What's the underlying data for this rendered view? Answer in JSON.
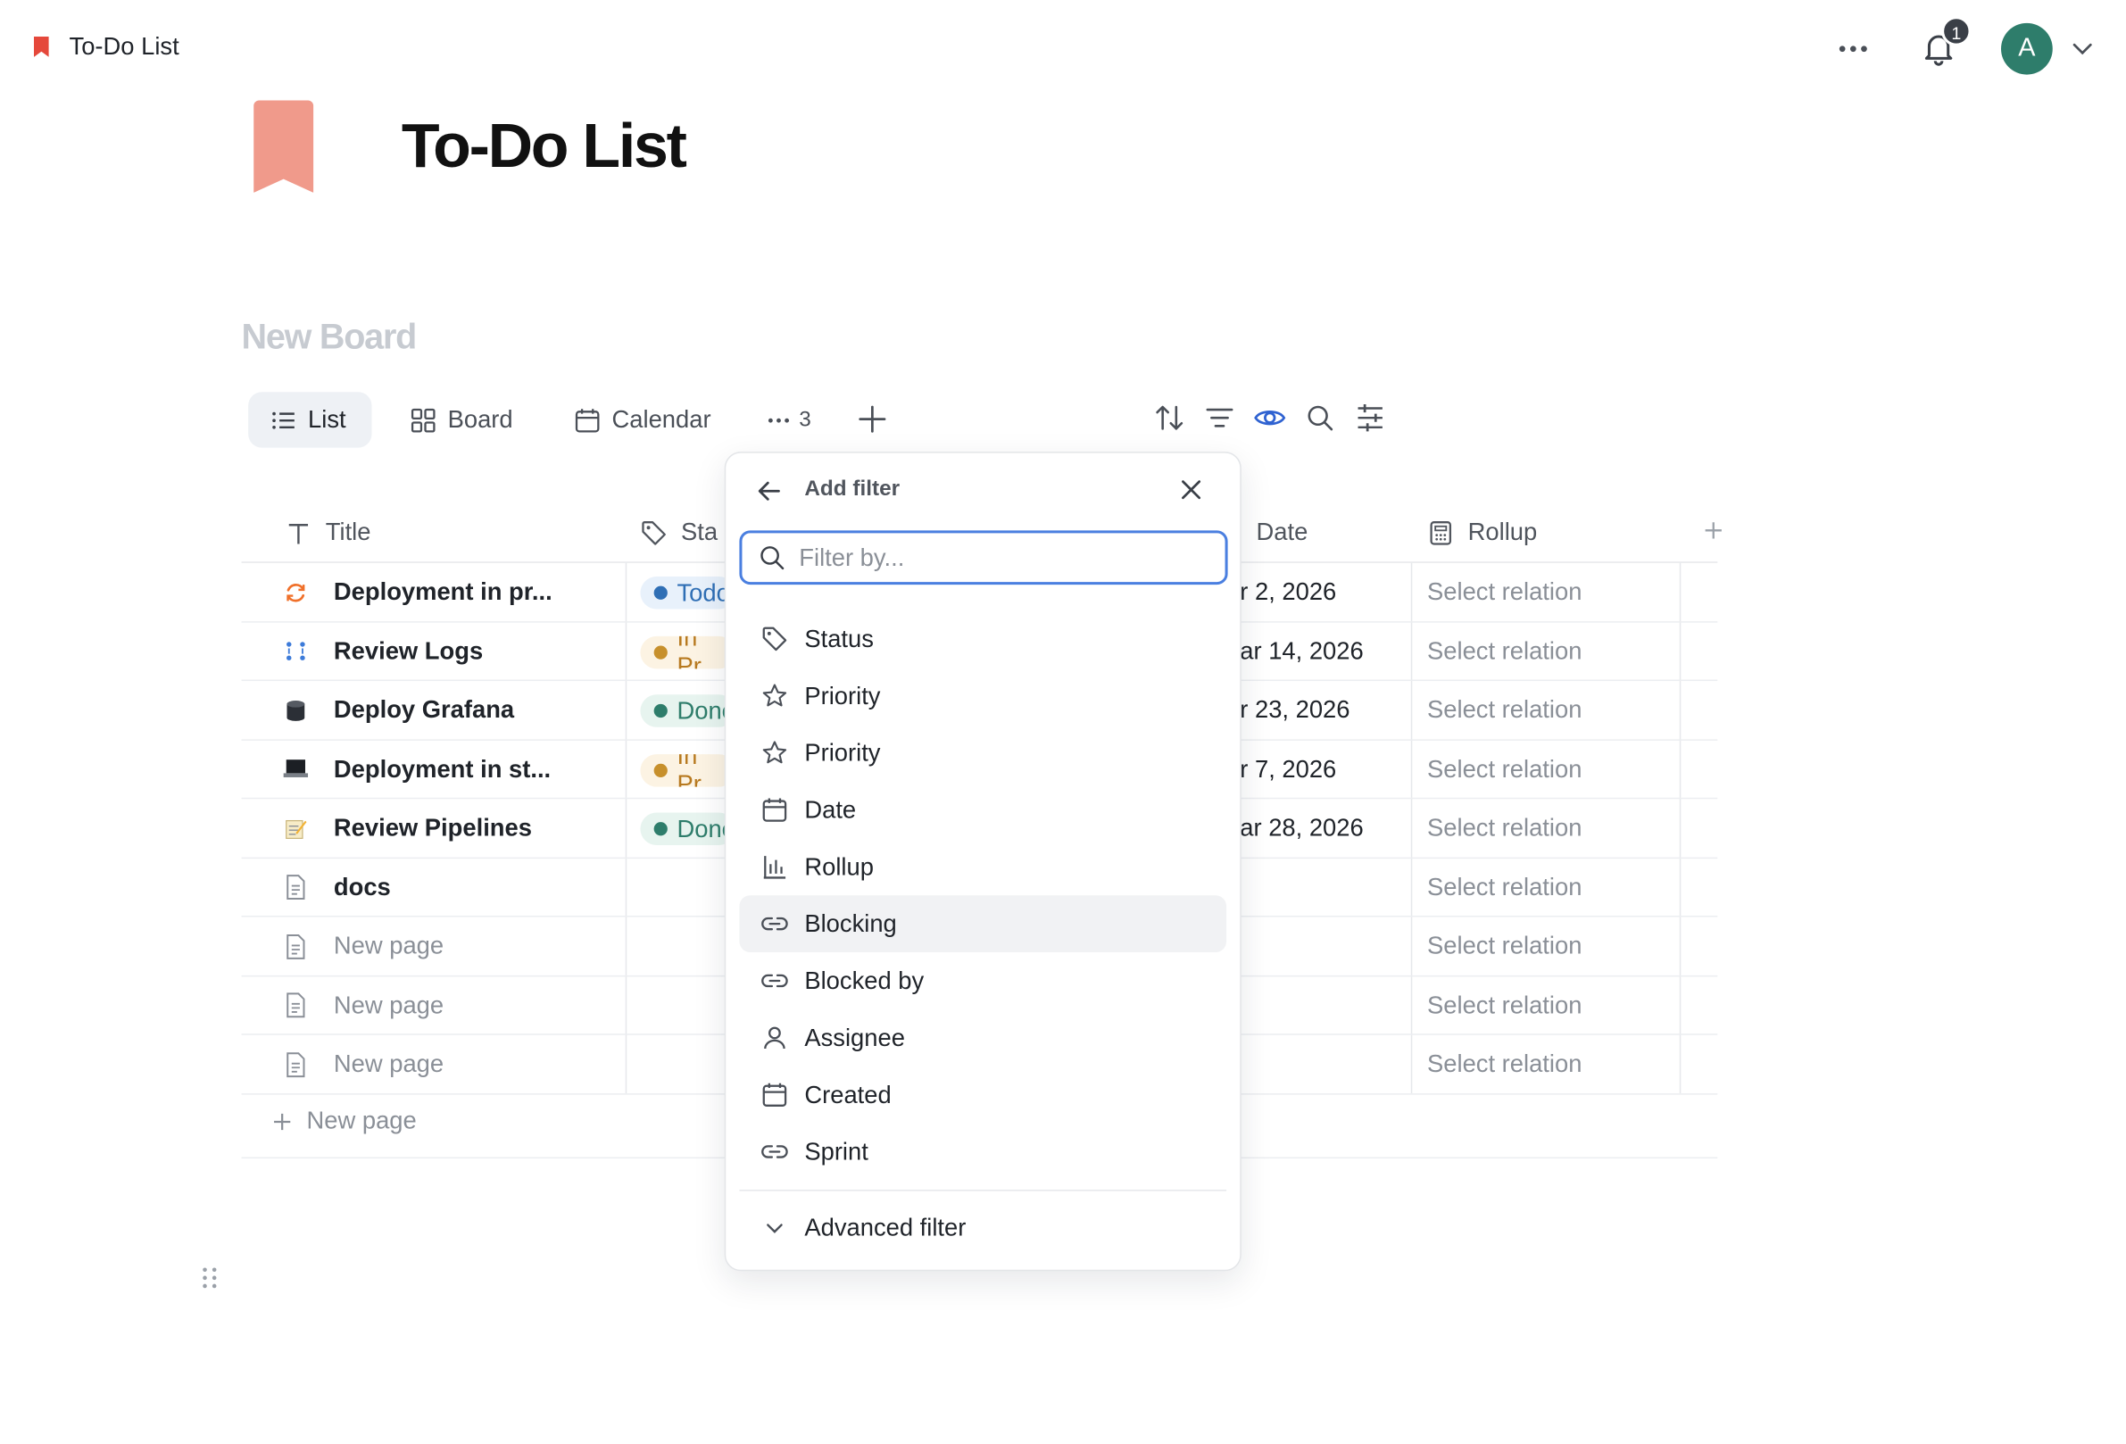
{
  "topbar": {
    "title": "To-Do List",
    "notification_count": "1",
    "avatar_initial": "A"
  },
  "page": {
    "title": "To-Do List",
    "board_title": "New Board"
  },
  "tabs": [
    {
      "label": "List",
      "icon": "list-icon",
      "active": true
    },
    {
      "label": "Board",
      "icon": "board-icon",
      "active": false
    },
    {
      "label": "Calendar",
      "icon": "calendar-icon",
      "active": false
    }
  ],
  "more_views_count": "3",
  "toolbar_icons": [
    "sort-icon",
    "filter-icon",
    "eye-icon",
    "search-icon",
    "settings-sliders-icon"
  ],
  "table": {
    "columns": [
      {
        "label": "Title",
        "icon": "text-icon"
      },
      {
        "label": "Sta",
        "icon": "tag-icon"
      },
      {
        "label": "Date",
        "icon": "calendar-icon"
      },
      {
        "label": "Rollup",
        "icon": "calculator-icon"
      }
    ],
    "rows": [
      {
        "title": "Deployment in pr...",
        "icon": "sync-icon",
        "status": "Todo",
        "status_color": "#2f6fb5",
        "status_bg": "#e8f1fb",
        "date": "r 2, 2026",
        "rollup": "Select relation"
      },
      {
        "title": "Review Logs",
        "icon": "dots-grid-icon",
        "status": "In Pr",
        "status_color": "#b7791f",
        "status_bg": "#fcf3e3",
        "date": "ar 14, 2026",
        "rollup": "Select relation"
      },
      {
        "title": "Deploy Grafana",
        "icon": "database-icon",
        "status": "Done",
        "status_color": "#2e7d6b",
        "status_bg": "#e7f4ef",
        "date": "r 23, 2026",
        "rollup": "Select relation"
      },
      {
        "title": "Deployment in st...",
        "icon": "laptop-icon",
        "status": "In Pr",
        "status_color": "#b7791f",
        "status_bg": "#fcf3e3",
        "date": "r 7, 2026",
        "rollup": "Select relation"
      },
      {
        "title": "Review Pipelines",
        "icon": "memo-icon",
        "status": "Done",
        "status_color": "#2e7d6b",
        "status_bg": "#e7f4ef",
        "date": "ar 28, 2026",
        "rollup": "Select relation"
      },
      {
        "title": "docs",
        "icon": "page-icon",
        "status": "",
        "date": "",
        "rollup": "Select relation"
      },
      {
        "title": "New page",
        "icon": "page-icon",
        "status": "",
        "date": "",
        "rollup": "Select relation",
        "muted": true
      },
      {
        "title": "New page",
        "icon": "page-icon",
        "status": "",
        "date": "",
        "rollup": "Select relation",
        "muted": true
      },
      {
        "title": "New page",
        "icon": "page-icon",
        "status": "",
        "date": "",
        "rollup": "Select relation",
        "muted": true
      }
    ],
    "new_page_label": "New page"
  },
  "filter_popover": {
    "title": "Add filter",
    "search_placeholder": "Filter by...",
    "items": [
      {
        "label": "Status",
        "icon": "tag-icon"
      },
      {
        "label": "Priority",
        "icon": "star-icon"
      },
      {
        "label": "Priority",
        "icon": "star-icon"
      },
      {
        "label": "Date",
        "icon": "calendar-icon"
      },
      {
        "label": "Rollup",
        "icon": "bar-chart-icon"
      },
      {
        "label": "Blocking",
        "icon": "link-icon",
        "hover": true
      },
      {
        "label": "Blocked by",
        "icon": "link-icon"
      },
      {
        "label": "Assignee",
        "icon": "person-icon"
      },
      {
        "label": "Created",
        "icon": "calendar-icon"
      },
      {
        "label": "Sprint",
        "icon": "link-icon"
      }
    ],
    "advanced_label": "Advanced filter"
  },
  "colors": {
    "accent": "#4a7fe0",
    "bookmark": "#f09a8b",
    "bookmark_small": "#e5483b",
    "avatar": "#2e7d6b"
  }
}
